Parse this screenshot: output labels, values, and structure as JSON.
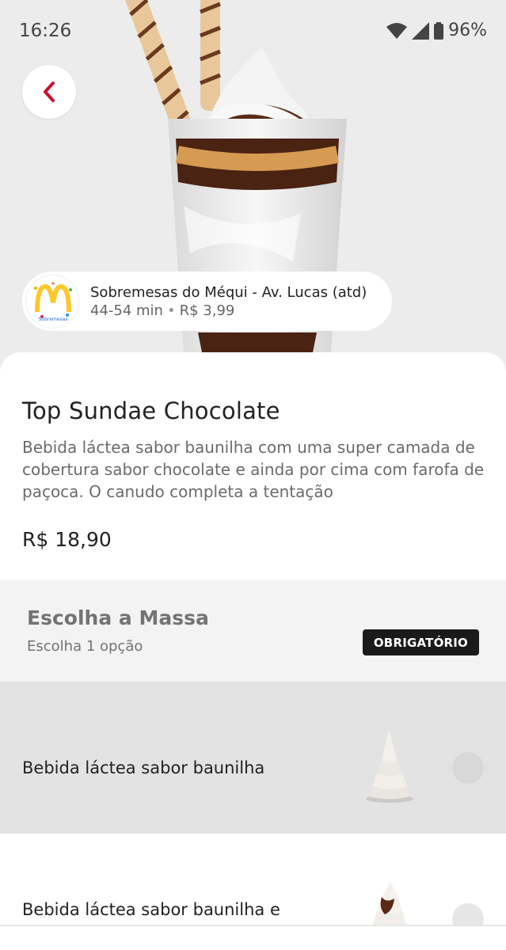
{
  "status_bar": {
    "time": "16:26",
    "battery": "96%",
    "icons": [
      "wifi-icon",
      "signal-icon",
      "battery-icon"
    ]
  },
  "navigation": {
    "back_icon": "chevron-left-icon"
  },
  "store": {
    "logo_text": "Sobremesas",
    "name": "Sobremesas do Méqui  - Av. Lucas (atd)",
    "delivery_time": "44-54 min",
    "separator": "•",
    "delivery_fee": "R$ 3,99"
  },
  "product": {
    "title": "Top Sundae Chocolate",
    "description": "Bebida láctea sabor baunilha com uma super camada de cobertura sabor chocolate e ainda por cima com farofa de paçoca. O canudo completa a tentação",
    "price": "R$ 18,90"
  },
  "option_group": {
    "title": "Escolha a Massa",
    "subtitle": "Escolha 1 opção",
    "badge": "OBRIGATÓRIO",
    "options": [
      {
        "label": "Bebida láctea sabor baunilha",
        "selected": false
      },
      {
        "label": "Bebida láctea sabor baunilha e",
        "selected": false
      }
    ]
  },
  "colors": {
    "accent": "#c8102e",
    "badge_bg": "#1a1a1a",
    "group_bg": "#f3f3f3",
    "option_pressed_bg": "#e3e3e3"
  }
}
